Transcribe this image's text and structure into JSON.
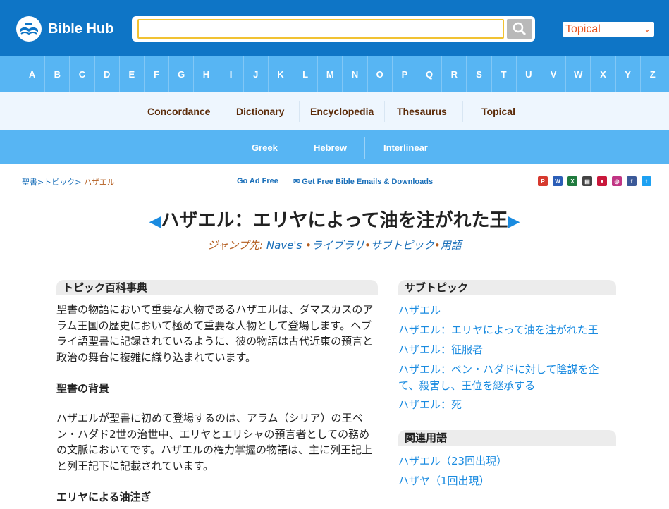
{
  "header": {
    "logo_text": "Bible Hub",
    "search_value": "",
    "select_value": "Topical"
  },
  "alphabet": [
    "A",
    "B",
    "C",
    "D",
    "E",
    "F",
    "G",
    "H",
    "I",
    "J",
    "K",
    "L",
    "M",
    "N",
    "O",
    "P",
    "Q",
    "R",
    "S",
    "T",
    "U",
    "V",
    "W",
    "X",
    "Y",
    "Z"
  ],
  "nav_primary": [
    "Concordance",
    "Dictionary",
    "Encyclopedia",
    "Thesaurus",
    "Topical"
  ],
  "nav_secondary": [
    "Greek",
    "Hebrew",
    "Interlinear"
  ],
  "breadcrumb": {
    "item1": "聖書",
    "item2": "トピック",
    "current": "ハザエル"
  },
  "utility": {
    "ad_free": "Go Ad Free",
    "emails": "✉ Get Free Bible Emails & Downloads"
  },
  "share_icons": [
    "pdf-icon",
    "word-icon",
    "excel-icon",
    "print-icon",
    "heart-icon",
    "instagram-icon",
    "facebook-icon",
    "twitter-icon"
  ],
  "title": {
    "prev_arrow": "◀",
    "text": "ハザエル：エリヤによって油を注がれた王",
    "next_arrow": "▶"
  },
  "jump": {
    "label": "ジャンプ先:",
    "links": [
      "Nave's",
      "ライブラリ",
      "サブトピック",
      "用語"
    ]
  },
  "encyclopedia": {
    "heading": "トピック百科事典",
    "intro": "聖書の物語において重要な人物であるハザエルは、ダマスカスのアラム王国の歴史において極めて重要な人物として登場します。ヘブライ語聖書に記録されているように、彼の物語は古代近東の預言と政治の舞台に複雑に織り込まれています。",
    "section1_title": "聖書の背景",
    "section1_text": "ハザエルが聖書に初めて登場するのは、アラム（シリア）の王ベン・ハダド2世の治世中、エリヤとエリシャの預言者としての務めの文脈においてです。ハザエルの権力掌握の物語は、主に列王記上と列王記下に記載されています。",
    "section2_title": "エリヤによる油注ぎ"
  },
  "subtopics": {
    "heading": "サブトピック",
    "items": [
      "ハザエル",
      "ハザエル：エリヤによって油を注がれた王",
      "ハザエル：征服者",
      "ハザエル：ベン・ハダドに対して陰謀を企て、殺害し、王位を継承する",
      "ハザエル：死"
    ]
  },
  "related": {
    "heading": "関連用語",
    "items": [
      "ハザエル（23回出現）",
      "ハザヤ（1回出現）"
    ]
  },
  "colors": {
    "header_blue": "#0e75c6",
    "nav_light_blue": "#57b5f3",
    "link_blue": "#1a8be0",
    "accent_orange": "#e8511b",
    "nav_brown": "#5c2c0a"
  }
}
